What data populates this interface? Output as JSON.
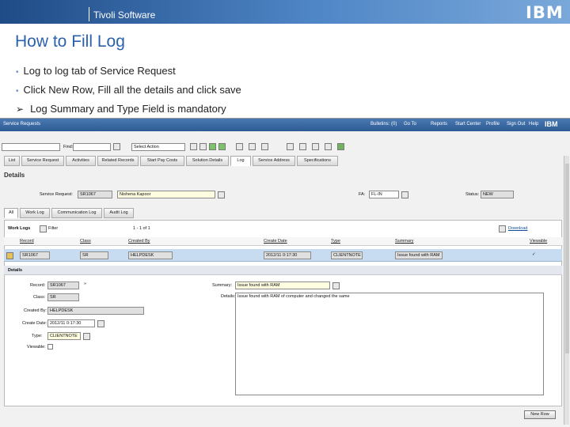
{
  "banner": {
    "brand": "Tivoli Software",
    "logo": "IBM"
  },
  "slide": {
    "title": "How to Fill Log",
    "bullets": [
      {
        "text": "Log to log tab of Service Request",
        "marker": "•"
      },
      {
        "text": "Click New Row, Fill all the details and click save",
        "marker": "•"
      },
      {
        "text": "Log Summary and Type Field is mandatory",
        "marker": "➢"
      }
    ]
  },
  "app": {
    "title": "Service Requests",
    "menu": [
      "Bulletins: (0)",
      "Go To",
      "Reports",
      "Start Center",
      "Profile",
      "Sign Out",
      "Help"
    ],
    "find_label": "Find:",
    "select_action": "Select Action",
    "tabs": [
      "List",
      "Service Request",
      "Activities",
      "Related Records",
      "Start Pay Costs",
      "Solution Details",
      "Log",
      "Service Address",
      "Specifications"
    ],
    "active_tab": "Log",
    "details_heading": "Details",
    "service_request_label": "Service Request:",
    "service_request_value": "SR1067",
    "description_value": "Nishena Kapoor",
    "fa_label": "FA:",
    "fa_value": "FL-IN",
    "status_label": "Status:",
    "status_value": "NEW",
    "subtabs": [
      "All",
      "Work Log",
      "Communication Log",
      "Audit Log"
    ],
    "active_subtab": "All",
    "worklogs_label": "Work Logs",
    "filter_label": "Filter",
    "pager": "1 - 1 of 1",
    "download_label": "Download",
    "columns": [
      "Record",
      "Class",
      "Created By",
      "Create Date",
      "Type",
      "Summary",
      "Viewable"
    ],
    "row": {
      "record": "SR1067",
      "class": "SR",
      "created_by": "HELPDESK",
      "create_date": "2012/11 0:17:30",
      "type": "CLIENTNOTE",
      "summary": "Issue found with RAM",
      "viewable": "✓"
    },
    "detail_heading": "Details",
    "detail": {
      "record_label": "Record:",
      "record_value": "SR1067",
      "class_label": "Class:",
      "class_value": "SR",
      "created_by_label": "Created By:",
      "created_by_value": "HELPDESK",
      "create_date_label": "Create Date:",
      "create_date_value": "2012/11 0:17:30",
      "type_label": "Type:",
      "type_value": "CLIENTNOTE",
      "viewable_label": "Viewable:",
      "summary_label": "Summary:",
      "summary_value": "Issue found with RAM",
      "details_label": "Details:",
      "details_value": "Issue found with RAM of computer and changed the same"
    },
    "new_row_label": "New Row"
  }
}
